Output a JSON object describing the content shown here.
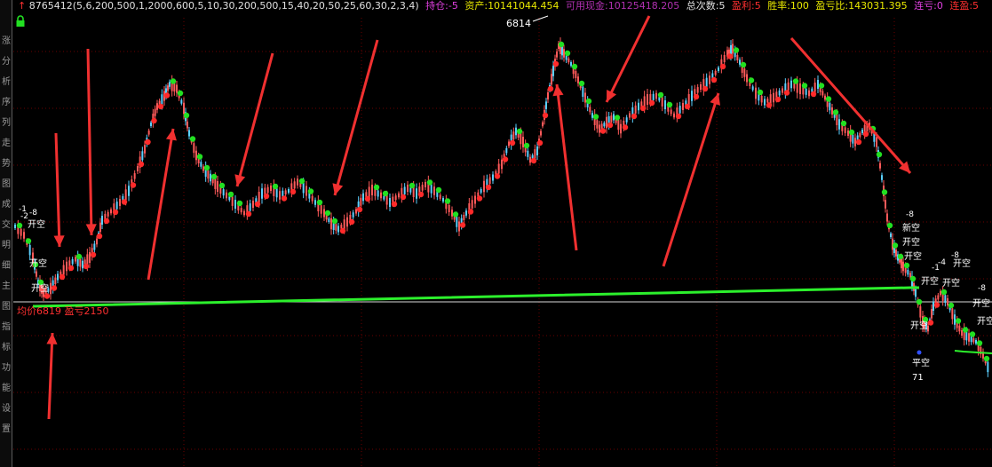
{
  "header": {
    "formula": "8765412(5,6,200,500,1,2000,600,5,10,30,200,500,15,40,20,50,25,60,30,2,3,4)",
    "position": {
      "label": "持仓:",
      "value": "-5"
    },
    "assets": {
      "label": "资产:",
      "value": "10141044.454"
    },
    "available_cash": {
      "label": "可用现金:",
      "value": "10125418.205"
    },
    "total_trades": {
      "label": "总次数:",
      "value": "5"
    },
    "profit_count": {
      "label": "盈利:",
      "value": "5"
    },
    "win_rate": {
      "label": "胜率:",
      "value": "100"
    },
    "profit_loss_ratio": {
      "label": "盈亏比:",
      "value": "143031.395"
    },
    "win_streak": {
      "label": "连亏:",
      "value": "0"
    },
    "loss_streak": {
      "label": "连盈:",
      "value": "5"
    }
  },
  "left_labels": [
    "涨",
    "分",
    "析",
    "序",
    "列",
    "走",
    "势",
    "图",
    "成",
    "交",
    "明",
    "细",
    "主",
    "图",
    "指",
    "标",
    "功",
    "能",
    "设",
    "置"
  ],
  "chart_labels": {
    "peak_price": "6814",
    "avg_price_line": "均价6819 盈亏2150",
    "flat_short": "平空",
    "flat_short_qty": "71",
    "open_short": "开空",
    "new_open_short": "新空",
    "qty_neg1": "-1",
    "qty_neg2": "-2",
    "qty_neg4": "-4",
    "qty_neg8": "-8"
  },
  "colors": {
    "accent_up": "#ff2a2a",
    "accent_down": "#22e022",
    "avg_line": "#2cf02c",
    "label_yellow": "#e8e800",
    "label_magenta": "#e040e0",
    "label_red": "#ff3030",
    "grid": "#6a0000"
  },
  "icons": [
    "lock-icon",
    "up-arrow-icon"
  ]
}
